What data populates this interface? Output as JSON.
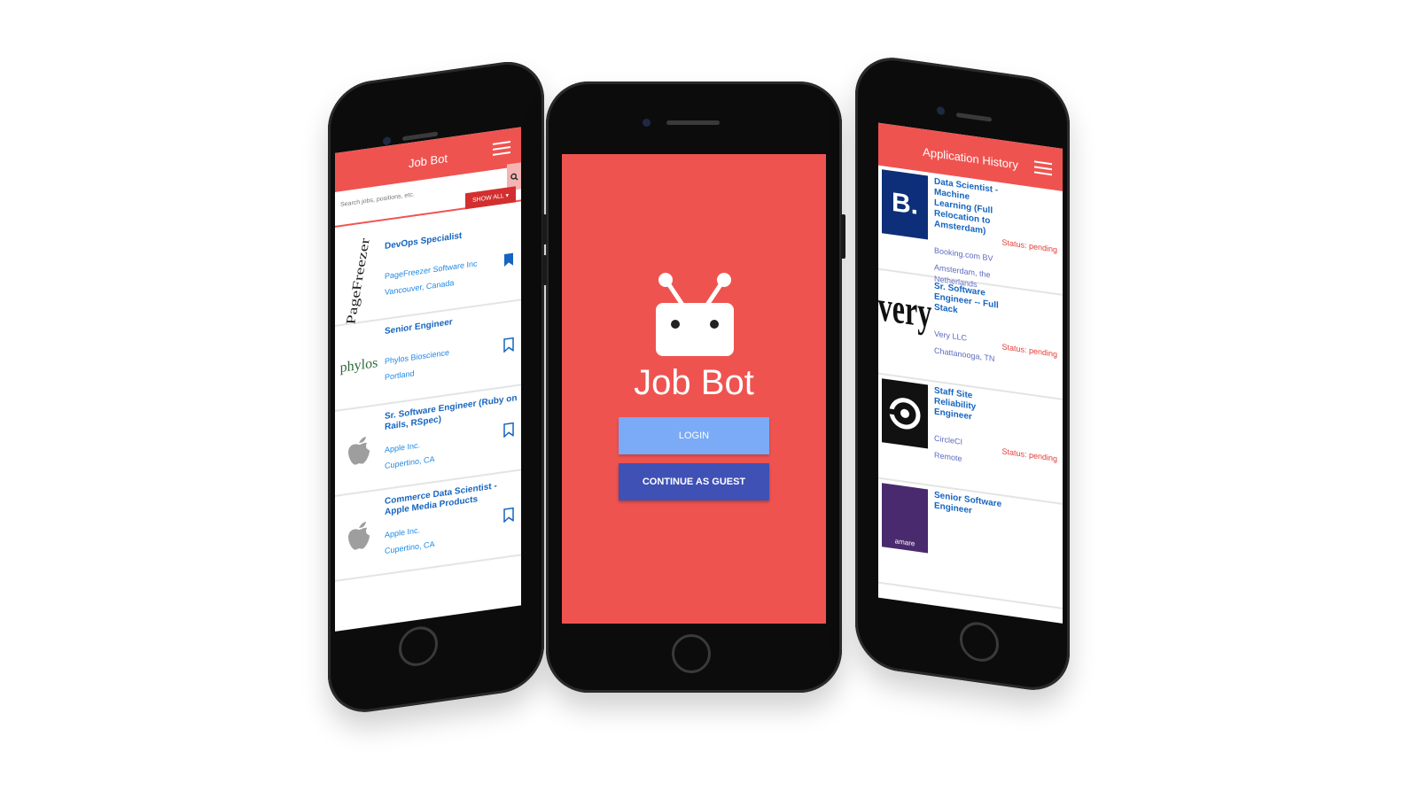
{
  "left_phone": {
    "header_title": "Job Bot",
    "search_placeholder": "Search jobs, positions, etc.",
    "show_all_label": "SHOW ALL ▾",
    "jobs": [
      {
        "title": "DevOps Specialist",
        "company": "PageFreezer Software Inc",
        "location": "Vancouver, Canada",
        "logo": "PageFreezer",
        "bookmarked": true
      },
      {
        "title": "Senior Engineer",
        "company": "Phylos Bioscience",
        "location": "Portland",
        "logo": "phylos",
        "bookmarked": false
      },
      {
        "title": "Sr. Software Engineer (Ruby on Rails, RSpec)",
        "company": "Apple Inc.",
        "location": "Cupertino, CA",
        "logo": "apple-icon",
        "bookmarked": false
      },
      {
        "title": "Commerce Data Scientist - Apple Media Products",
        "company": "Apple Inc.",
        "location": "Cupertino, CA",
        "logo": "apple-icon",
        "bookmarked": false
      }
    ]
  },
  "center_phone": {
    "app_name": "Job Bot",
    "login_label": "LOGIN",
    "guest_label": "CONTINUE AS GUEST"
  },
  "right_phone": {
    "header_title": "Application History",
    "applications": [
      {
        "title": "Data Scientist - Machine Learning (Full Relocation to Amsterdam)",
        "company": "Booking.com BV",
        "location": "Amsterdam, the Netherlands",
        "status": "Status: pending",
        "logo": "B."
      },
      {
        "title": "Sr. Software Engineer -- Full Stack",
        "company": "Very LLC",
        "location": "Chattanooga, TN",
        "status": "Status: pending",
        "logo": "very"
      },
      {
        "title": "Staff Site Reliability Engineer",
        "company": "CircleCI",
        "location": "Remote",
        "status": "Status: pending",
        "logo": "circleci-icon"
      },
      {
        "title": "Senior Software Engineer",
        "company": "",
        "location": "",
        "status": "",
        "logo": "amare"
      }
    ]
  },
  "colors": {
    "primary": "#ef5350",
    "link_blue": "#1565c0",
    "login_button": "#7baaf7",
    "guest_button": "#3f51b5",
    "status_red": "#e53935"
  }
}
